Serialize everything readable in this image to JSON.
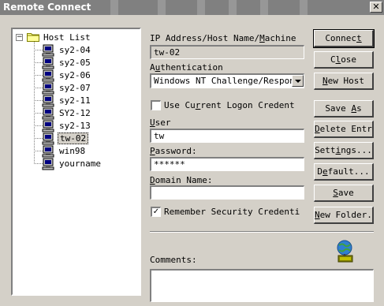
{
  "window": {
    "title": "Remote Connect"
  },
  "tree": {
    "root_label": "Host List",
    "items": [
      {
        "label": "sy2-04"
      },
      {
        "label": "sy2-05"
      },
      {
        "label": "sy2-06"
      },
      {
        "label": "sy2-07"
      },
      {
        "label": "sy2-11"
      },
      {
        "label": "SY2-12"
      },
      {
        "label": "sy2-13"
      },
      {
        "label": "tw-02",
        "selected": true
      },
      {
        "label": "win98"
      },
      {
        "label": "yourname"
      }
    ]
  },
  "form": {
    "host_label": {
      "pre": "IP Address/Host Name/",
      "u": "M",
      "post": "achine"
    },
    "host_value": "tw-02",
    "auth_label": {
      "pre": "A",
      "u": "u",
      "post": "thentication"
    },
    "auth_value": "Windows NT Challenge/Response",
    "use_logon_label": {
      "pre": "Use Cu",
      "u": "r",
      "post": "rent Logon Credent"
    },
    "use_logon_checked": false,
    "user_label": {
      "pre": "",
      "u": "U",
      "post": "ser"
    },
    "user_value": "tw",
    "password_label": {
      "pre": "",
      "u": "P",
      "post": "assword:"
    },
    "password_value": "******",
    "domain_label": {
      "pre": "",
      "u": "D",
      "post": "omain Name:"
    },
    "domain_value": "",
    "remember_label": {
      "pre": "Remember Security Credenti",
      "u": "",
      "post": ""
    },
    "remember_checked": true,
    "comments_label": "Comments:",
    "comments_value": ""
  },
  "buttons": {
    "connect": {
      "pre": "Connec",
      "u": "t",
      "post": ""
    },
    "close": {
      "pre": "C",
      "u": "l",
      "post": "ose"
    },
    "new_host": {
      "pre": "",
      "u": "N",
      "post": "ew Host"
    },
    "save_as": {
      "pre": "Save ",
      "u": "A",
      "post": "s"
    },
    "delete_entry": {
      "pre": "",
      "u": "D",
      "post": "elete Entry"
    },
    "settings": {
      "pre": "Sett",
      "u": "i",
      "post": "ngs..."
    },
    "default": {
      "pre": "D",
      "u": "e",
      "post": "fault..."
    },
    "save": {
      "pre": "",
      "u": "S",
      "post": "ave"
    },
    "new_folder": {
      "pre": "",
      "u": "N",
      "post": "ew Folder..."
    }
  },
  "colors": {
    "face": "#d4d0c8",
    "titlebar": "#808080",
    "field": "#ffffff",
    "shadow": "#808080"
  },
  "icons": {
    "tree_root": "folder-icon",
    "tree_items": "computer-icon",
    "globe": "globe-network-icon"
  }
}
